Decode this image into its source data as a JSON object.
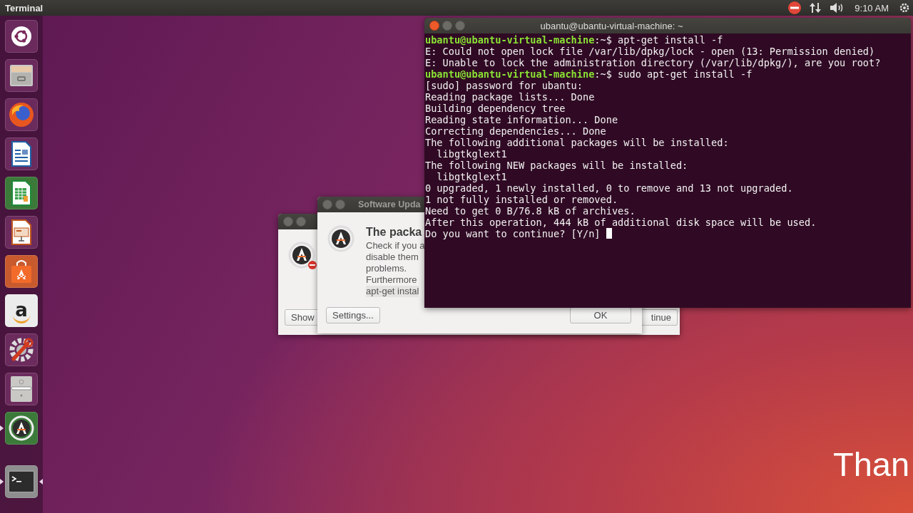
{
  "top_bar": {
    "app_title": "Terminal",
    "clock": "9:10 AM"
  },
  "launcher": {
    "items": [
      {
        "kind": "ubuntu",
        "running": false,
        "focused": false
      },
      {
        "kind": "files",
        "running": false,
        "focused": false
      },
      {
        "kind": "browser",
        "running": false,
        "focused": false
      },
      {
        "kind": "writer",
        "running": false,
        "focused": false
      },
      {
        "kind": "calc",
        "running": false,
        "focused": false
      },
      {
        "kind": "impress",
        "running": false,
        "focused": false
      },
      {
        "kind": "software",
        "running": false,
        "focused": false
      },
      {
        "kind": "store",
        "glyph": "a",
        "running": false,
        "focused": false
      },
      {
        "kind": "settings",
        "running": false,
        "focused": false
      },
      {
        "kind": "drive",
        "running": false,
        "focused": false
      },
      {
        "kind": "updater",
        "running": true,
        "focused": false
      },
      {
        "kind": "terminal",
        "running": true,
        "focused": true
      }
    ]
  },
  "back_dialog": {
    "buttons": [
      "Show",
      "tinue"
    ]
  },
  "front_dialog": {
    "title": "Software Upda",
    "heading": "The packa",
    "lines": [
      "Check if you a",
      "disable them",
      "problems.",
      "Furthermore"
    ],
    "command": "apt-get instal",
    "buttons": [
      "Settings...",
      "OK"
    ]
  },
  "terminal": {
    "title": "ubantu@ubantu-virtual-machine: ~",
    "lines": [
      {
        "kind": "prompt",
        "user": "ubantu@ubantu-virtual-machine",
        "path": ":~$",
        "command": "apt-get install -f"
      },
      {
        "kind": "output",
        "text": "E: Could not open lock file /var/lib/dpkg/lock - open (13: Permission denied)"
      },
      {
        "kind": "output",
        "text": "E: Unable to lock the administration directory (/var/lib/dpkg/), are you root?"
      },
      {
        "kind": "prompt",
        "user": "ubantu@ubantu-virtual-machine",
        "path": ":~$",
        "command": "sudo apt-get install -f"
      },
      {
        "kind": "output",
        "text": "[sudo] password for ubantu:"
      },
      {
        "kind": "output",
        "text": "Reading package lists... Done"
      },
      {
        "kind": "output",
        "text": "Building dependency tree"
      },
      {
        "kind": "output",
        "text": "Reading state information... Done"
      },
      {
        "kind": "output",
        "text": "Correcting dependencies... Done"
      },
      {
        "kind": "output",
        "text": "The following additional packages will be installed:"
      },
      {
        "kind": "output",
        "text": "  libgtkglext1"
      },
      {
        "kind": "output",
        "text": "The following NEW packages will be installed:"
      },
      {
        "kind": "output",
        "text": "  libgtkglext1"
      },
      {
        "kind": "output",
        "text": "0 upgraded, 1 newly installed, 0 to remove and 13 not upgraded."
      },
      {
        "kind": "output",
        "text": "1 not fully installed or removed."
      },
      {
        "kind": "output",
        "text": "Need to get 0 B/76.8 kB of archives."
      },
      {
        "kind": "output",
        "text": "After this operation, 444 kB of additional disk space will be used."
      },
      {
        "kind": "output",
        "text": "Do you want to continue? [Y/n] ",
        "cursor": true
      }
    ]
  },
  "overlay_text": "Than"
}
